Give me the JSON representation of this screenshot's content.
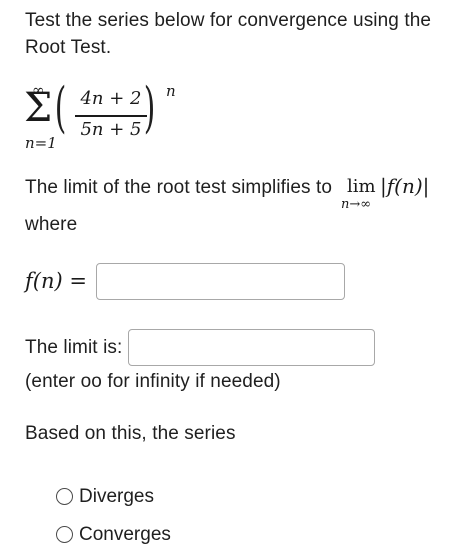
{
  "question": {
    "instruction_line1": "Test the series below for convergence using the",
    "instruction_line2": "Root Test.",
    "series": {
      "sigma": "Σ",
      "upper_limit": "∞",
      "lower_limit": "n=1",
      "left_paren": "(",
      "right_paren": ")",
      "numerator": "4n + 2",
      "denominator": "5n + 5",
      "exponent": "n"
    },
    "limit_sentence": "The limit of the root test simplifies to",
    "limit_word": "lim",
    "limit_subscript": "n→∞",
    "limit_function": "|f(n)|",
    "where_text": "where",
    "fn_label": "f(n) =",
    "fn_input_value": "",
    "limit_label": "The limit is:",
    "limit_input_value": "",
    "infinity_hint": "(enter oo for infinity if needed)",
    "conclusion_text": "Based on this, the series",
    "options": [
      {
        "label": "Diverges",
        "selected": false
      },
      {
        "label": "Converges",
        "selected": false
      }
    ]
  },
  "colors": {
    "text": "#1f1f1f",
    "input_border": "#a8a8a8",
    "radio_border": "#4a4a4a",
    "background": "#ffffff"
  }
}
